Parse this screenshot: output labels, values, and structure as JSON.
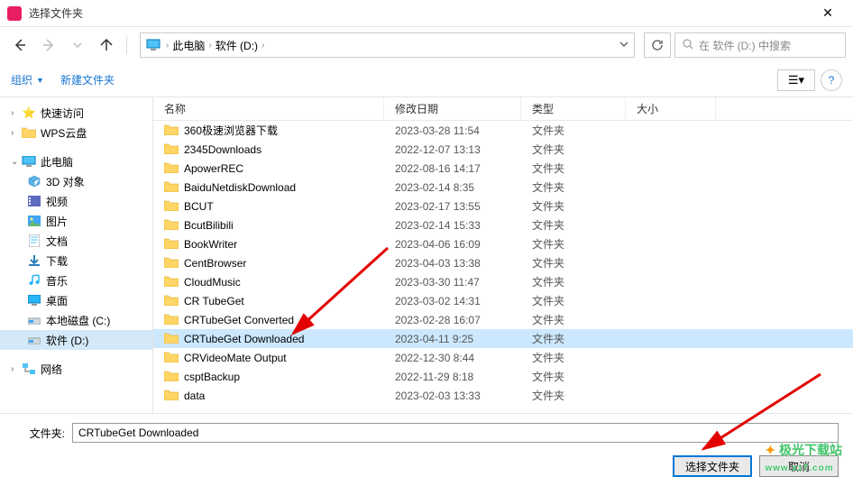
{
  "titlebar": {
    "title": "选择文件夹"
  },
  "breadcrumb": {
    "items": [
      "此电脑",
      "软件 (D:)"
    ]
  },
  "search": {
    "placeholder": "在 软件 (D:) 中搜索"
  },
  "toolbar": {
    "organize": "组织",
    "new_folder": "新建文件夹"
  },
  "columns": {
    "name": "名称",
    "date": "修改日期",
    "type": "类型",
    "size": "大小"
  },
  "sidebar": {
    "quick": "快速访问",
    "wps": "WPS云盘",
    "thispc": "此电脑",
    "d3": "3D 对象",
    "video": "视频",
    "pic": "图片",
    "doc": "文档",
    "dl": "下载",
    "music": "音乐",
    "desktop": "桌面",
    "cdrive": "本地磁盘 (C:)",
    "ddrive": "软件 (D:)",
    "network": "网络"
  },
  "files": [
    {
      "name": "360极速浏览器下载",
      "date": "2023-03-28 11:54",
      "type": "文件夹"
    },
    {
      "name": "2345Downloads",
      "date": "2022-12-07 13:13",
      "type": "文件夹"
    },
    {
      "name": "ApowerREC",
      "date": "2022-08-16 14:17",
      "type": "文件夹"
    },
    {
      "name": "BaiduNetdiskDownload",
      "date": "2023-02-14 8:35",
      "type": "文件夹"
    },
    {
      "name": "BCUT",
      "date": "2023-02-17 13:55",
      "type": "文件夹"
    },
    {
      "name": "BcutBilibili",
      "date": "2023-02-14 15:33",
      "type": "文件夹"
    },
    {
      "name": "BookWriter",
      "date": "2023-04-06 16:09",
      "type": "文件夹"
    },
    {
      "name": "CentBrowser",
      "date": "2023-04-03 13:38",
      "type": "文件夹"
    },
    {
      "name": "CloudMusic",
      "date": "2023-03-30 11:47",
      "type": "文件夹"
    },
    {
      "name": "CR TubeGet",
      "date": "2023-03-02 14:31",
      "type": "文件夹"
    },
    {
      "name": "CRTubeGet Converted",
      "date": "2023-02-28 16:07",
      "type": "文件夹"
    },
    {
      "name": "CRTubeGet Downloaded",
      "date": "2023-04-11 9:25",
      "type": "文件夹",
      "selected": true
    },
    {
      "name": "CRVideoMate Output",
      "date": "2022-12-30 8:44",
      "type": "文件夹"
    },
    {
      "name": "csptBackup",
      "date": "2022-11-29 8:18",
      "type": "文件夹"
    },
    {
      "name": "data",
      "date": "2023-02-03 13:33",
      "type": "文件夹"
    }
  ],
  "footer": {
    "label": "文件夹:",
    "value": "CRTubeGet Downloaded",
    "select": "选择文件夹",
    "cancel": "取消"
  },
  "watermark": {
    "main": "极光下载站",
    "sub": "www.xz7.com"
  }
}
